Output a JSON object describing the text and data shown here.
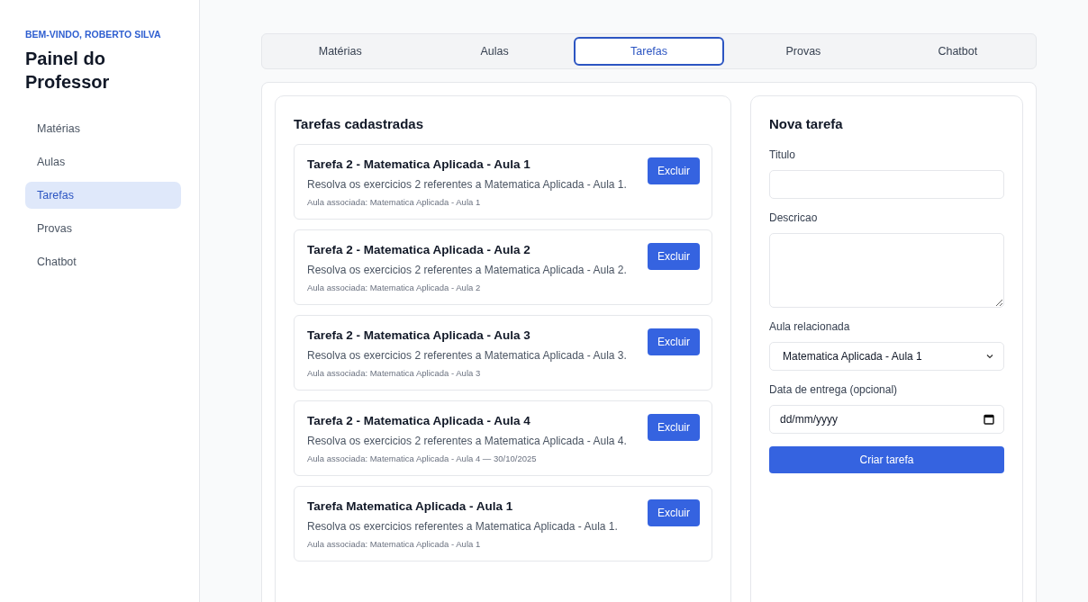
{
  "sidebar": {
    "greeting": "BEM-VINDO, ROBERTO SILVA",
    "title": "Painel do Professor",
    "items": [
      {
        "label": "Matérias",
        "selected": false
      },
      {
        "label": "Aulas",
        "selected": false
      },
      {
        "label": "Tarefas",
        "selected": true
      },
      {
        "label": "Provas",
        "selected": false
      },
      {
        "label": "Chatbot",
        "selected": false
      }
    ]
  },
  "tabs": [
    {
      "label": "Matérias",
      "selected": false
    },
    {
      "label": "Aulas",
      "selected": false
    },
    {
      "label": "Tarefas",
      "selected": true
    },
    {
      "label": "Provas",
      "selected": false
    },
    {
      "label": "Chatbot",
      "selected": false
    }
  ],
  "task_list": {
    "title": "Tarefas cadastradas",
    "tasks": [
      {
        "title": "Tarefa 2 - Matematica Aplicada - Aula 1",
        "description": "Resolva os exercicios 2 referentes a Matematica Aplicada - Aula 1.",
        "meta": "Aula associada: Matematica Aplicada - Aula 1",
        "button": "Excluir"
      },
      {
        "title": "Tarefa 2 - Matematica Aplicada - Aula 2",
        "description": "Resolva os exercicios 2 referentes a Matematica Aplicada - Aula 2.",
        "meta": "Aula associada: Matematica Aplicada - Aula 2",
        "button": "Excluir"
      },
      {
        "title": "Tarefa 2 - Matematica Aplicada - Aula 3",
        "description": "Resolva os exercicios 2 referentes a Matematica Aplicada - Aula 3.",
        "meta": "Aula associada: Matematica Aplicada - Aula 3",
        "button": "Excluir"
      },
      {
        "title": "Tarefa 2 - Matematica Aplicada - Aula 4",
        "description": "Resolva os exercicios 2 referentes a Matematica Aplicada - Aula 4.",
        "meta": "Aula associada: Matematica Aplicada - Aula 4 — 30/10/2025",
        "button": "Excluir"
      },
      {
        "title": "Tarefa Matematica Aplicada - Aula 1",
        "description": "Resolva os exercicios referentes a Matematica Aplicada - Aula 1.",
        "meta": "Aula associada: Matematica Aplicada - Aula 1",
        "button": "Excluir"
      }
    ]
  },
  "form": {
    "title": "Nova tarefa",
    "title_label": "Titulo",
    "description_label": "Descricao",
    "lesson_label": "Aula relacionada",
    "lesson_value": "Matematica Aplicada - Aula 1",
    "date_label": "Data de entrega (opcional)",
    "date_placeholder": "dd/mm/yyyy",
    "submit": "Criar tarefa"
  }
}
